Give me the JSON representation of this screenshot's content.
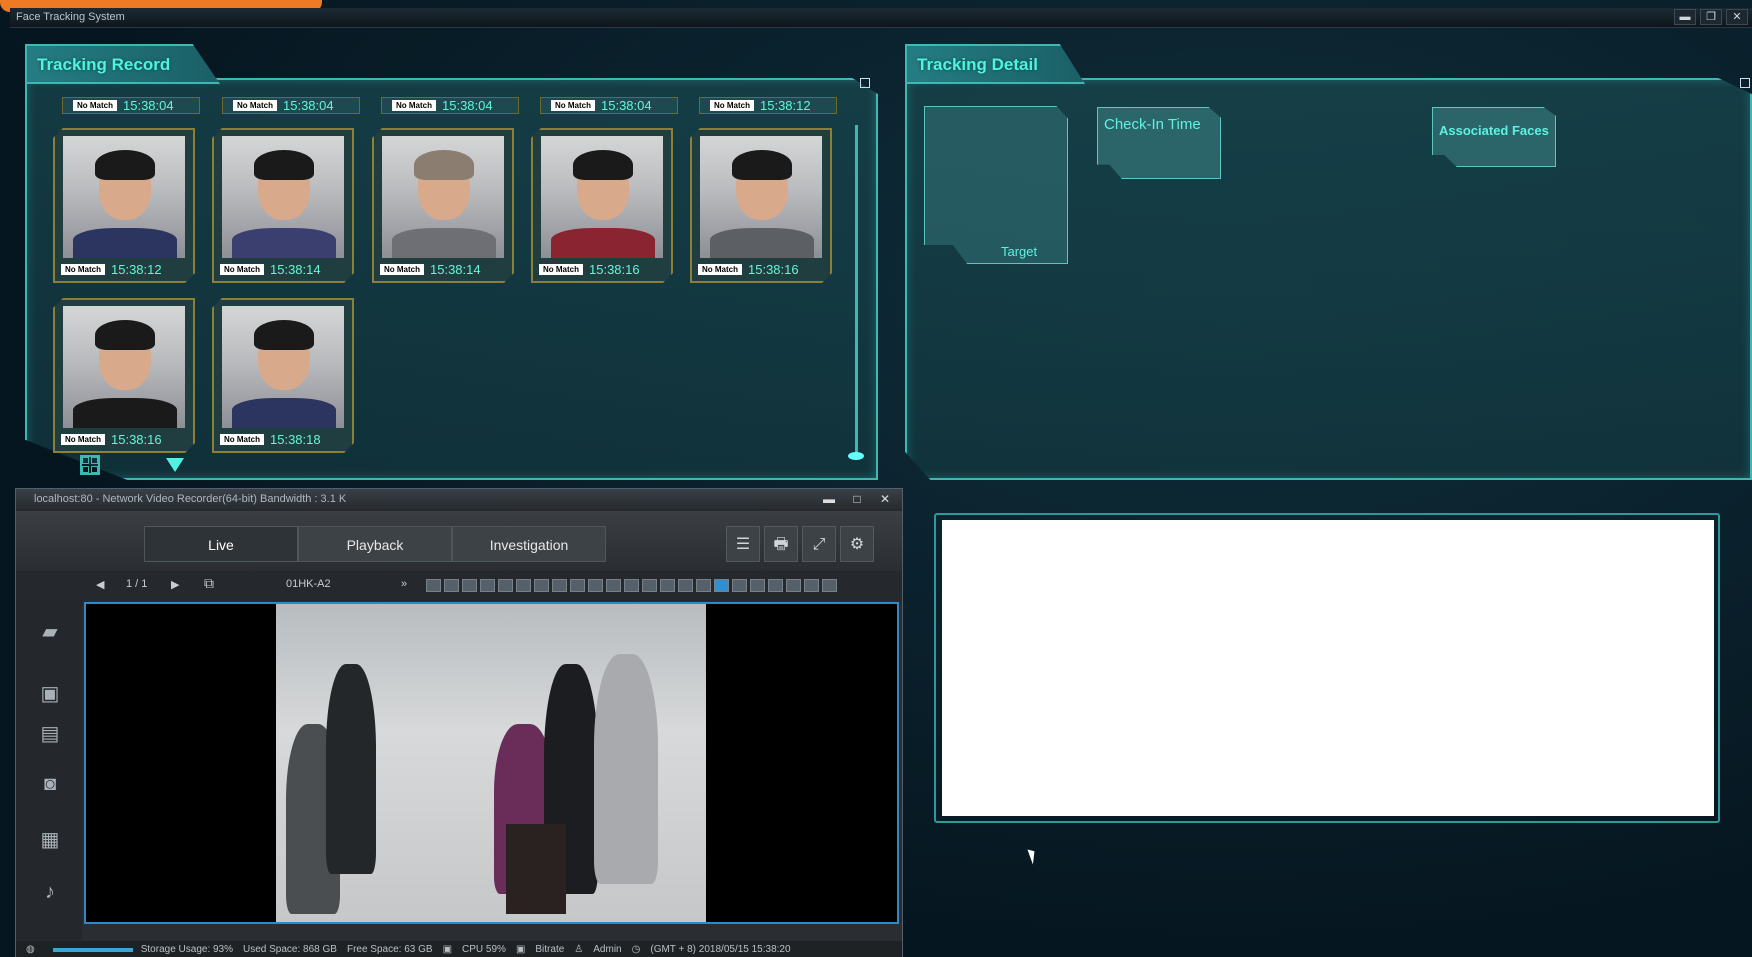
{
  "app": {
    "title": "Face Tracking System",
    "controls": [
      "▬",
      "❐",
      "✕"
    ]
  },
  "tracking_record": {
    "title": "Tracking Record",
    "top_labels": [
      {
        "match": "No Match",
        "time": "15:38:04"
      },
      {
        "match": "No Match",
        "time": "15:38:04"
      },
      {
        "match": "No Match",
        "time": "15:38:04"
      },
      {
        "match": "No Match",
        "time": "15:38:04"
      },
      {
        "match": "No Match",
        "time": "15:38:12"
      }
    ],
    "faces": [
      {
        "match": "No Match",
        "time": "15:38:12"
      },
      {
        "match": "No Match",
        "time": "15:38:14"
      },
      {
        "match": "No Match",
        "time": "15:38:14"
      },
      {
        "match": "No Match",
        "time": "15:38:16"
      },
      {
        "match": "No Match",
        "time": "15:38:16"
      },
      {
        "match": "No Match",
        "time": "15:38:16"
      },
      {
        "match": "No Match",
        "time": "15:38:18"
      }
    ]
  },
  "tracking_detail": {
    "title": "Tracking Detail",
    "target": "Target",
    "check_in": "Check-In Time",
    "associated": "Associated Faces"
  },
  "nvr": {
    "title": "localhost:80 - Network Video Recorder(64-bit)  Bandwidth : 3.1 K",
    "controls": [
      "▬",
      "□",
      "✕"
    ],
    "tabs": [
      "Live",
      "Playback",
      "Investigation"
    ],
    "tools": [
      "☰",
      "🖶",
      "⤢",
      "⚙"
    ],
    "page": "1 / 1",
    "channel": "01HK-A2",
    "status": {
      "storage": "Storage Usage: 93%",
      "used": "Used Space: 868 GB",
      "free": "Free Space: 63 GB",
      "cpu": "CPU 59%",
      "bitrate": "Bitrate",
      "user": "Admin",
      "datetime": "(GMT + 8) 2018/05/15 15:38:20"
    }
  },
  "colors": {
    "accent": "#4ff3df",
    "frame": "#3fb8b2",
    "badge_border": "#8a8038"
  }
}
